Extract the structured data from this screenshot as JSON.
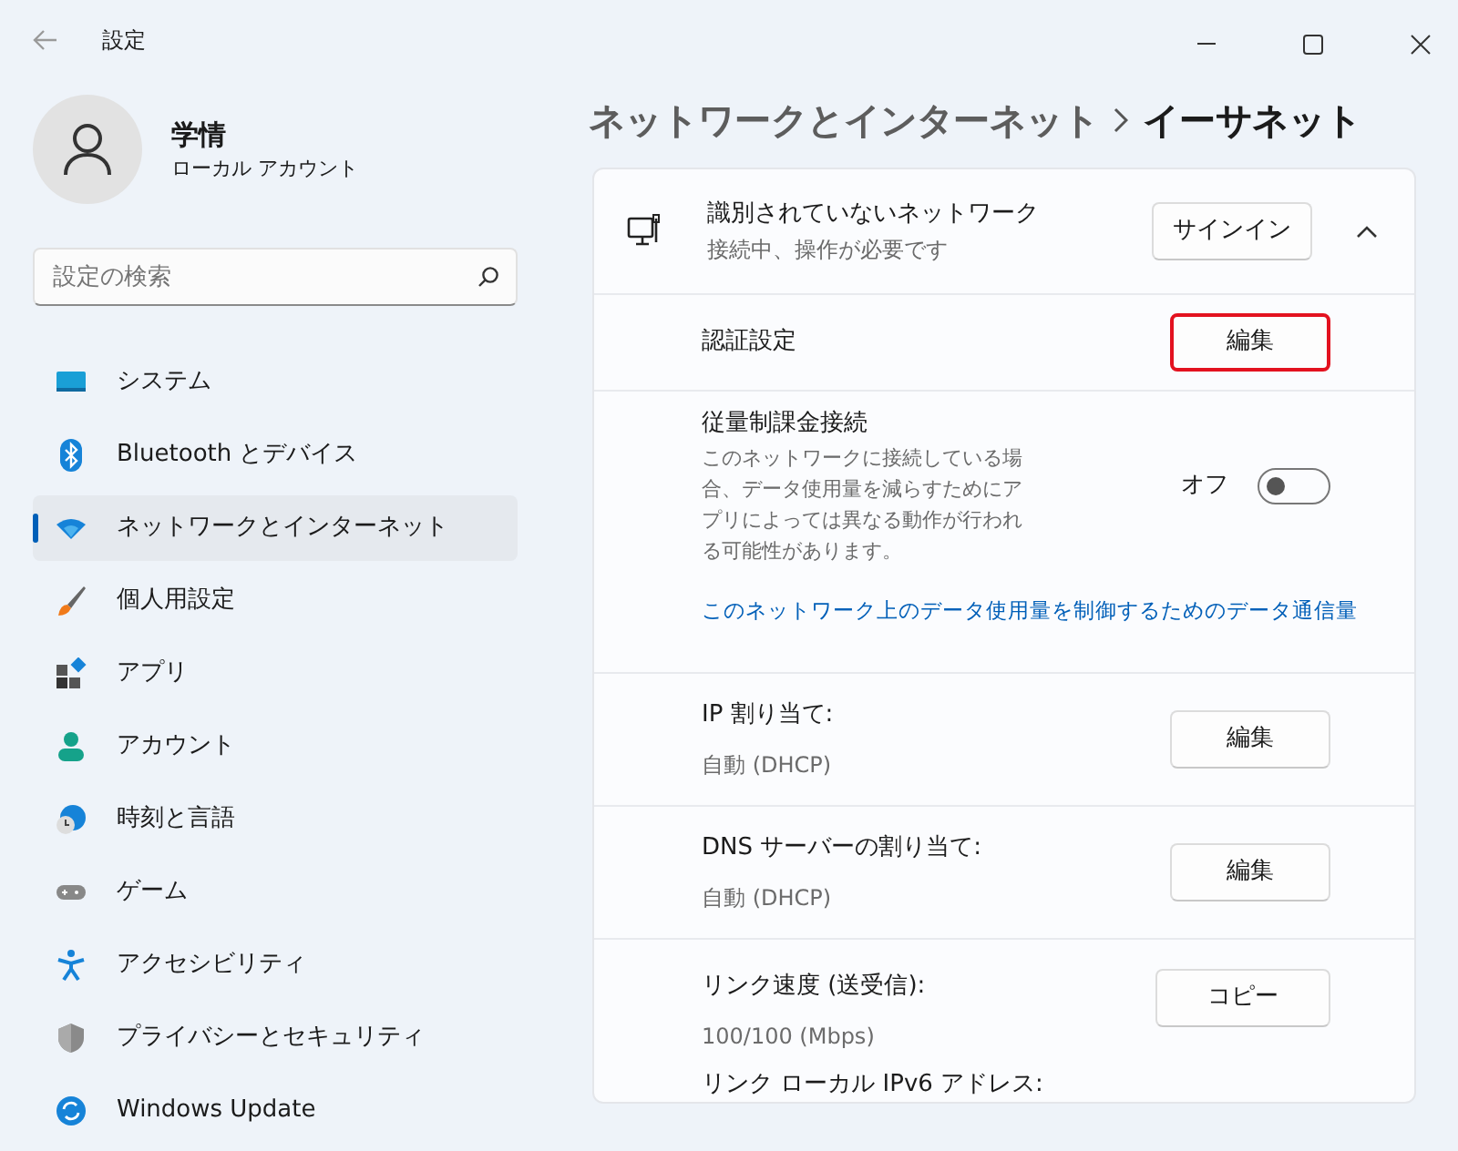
{
  "window": {
    "title": "設定"
  },
  "user": {
    "name": "学情",
    "account": "ローカル アカウント"
  },
  "search": {
    "placeholder": "設定の検索"
  },
  "sidebar": {
    "items": [
      {
        "label": "システム",
        "selected": false
      },
      {
        "label": "Bluetooth とデバイス",
        "selected": false
      },
      {
        "label": "ネットワークとインターネット",
        "selected": true
      },
      {
        "label": "個人用設定",
        "selected": false
      },
      {
        "label": "アプリ",
        "selected": false
      },
      {
        "label": "アカウント",
        "selected": false
      },
      {
        "label": "時刻と言語",
        "selected": false
      },
      {
        "label": "ゲーム",
        "selected": false
      },
      {
        "label": "アクセシビリティ",
        "selected": false
      },
      {
        "label": "プライバシーとセキュリティ",
        "selected": false
      },
      {
        "label": "Windows Update",
        "selected": false
      }
    ]
  },
  "breadcrumb": {
    "parent": "ネットワークとインターネット",
    "current": "イーサネット"
  },
  "network": {
    "name": "識別されていないネットワーク",
    "status": "接続中、操作が必要です",
    "button": "サインイン",
    "expanded": true
  },
  "rows": [
    {
      "kind": "button",
      "label": "認証設定",
      "button": "編集",
      "highlighted": true
    },
    {
      "kind": "toggle",
      "label": "従量制課金接続",
      "description": "このネットワークに接続している場合、データ使用量を減らすためにアプリによっては異なる動作が行われる可能性があります。",
      "state_label": "オフ",
      "on": false,
      "link": "このネットワーク上のデータ使用量を制御するためのデータ通信量"
    },
    {
      "kind": "button",
      "label": "IP 割り当て:",
      "value": "自動 (DHCP)",
      "button": "編集",
      "highlighted": false
    },
    {
      "kind": "button",
      "label": "DNS サーバーの割り当て:",
      "value": "自動 (DHCP)",
      "button": "編集",
      "highlighted": false
    },
    {
      "kind": "properties",
      "button": "コピー",
      "items": [
        {
          "label": "リンク速度 (送受信):",
          "value": "100/100 (Mbps)"
        },
        {
          "label": "リンク ローカル IPv6 アドレス:"
        }
      ]
    }
  ]
}
